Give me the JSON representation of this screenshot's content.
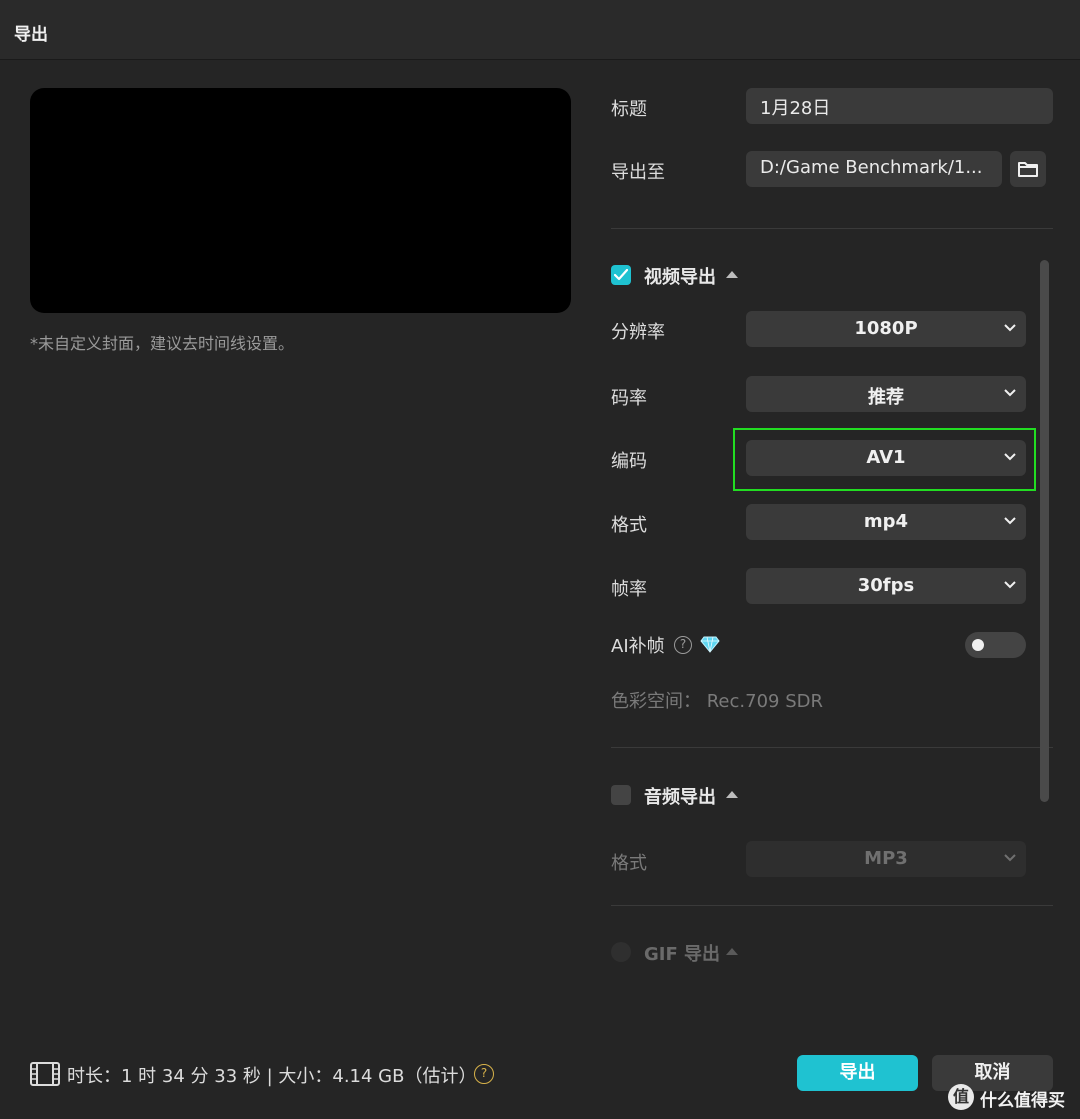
{
  "dialog": {
    "title": "导出"
  },
  "preview": {
    "hint": "*未自定义封面，建议去时间线设置。"
  },
  "form": {
    "title_label": "标题",
    "title_value": "1月28日",
    "export_to_label": "导出至",
    "export_path": "D:/Game Benchmark/1..."
  },
  "video": {
    "section_label": "视频导出",
    "checked": true,
    "resolution_label": "分辨率",
    "resolution_value": "1080P",
    "bitrate_label": "码率",
    "bitrate_value": "推荐",
    "codec_label": "编码",
    "codec_value": "AV1",
    "format_label": "格式",
    "format_value": "mp4",
    "framerate_label": "帧率",
    "framerate_value": "30fps",
    "ai_frame_label": "AI补帧",
    "ai_frame_enabled": false,
    "colorspace_text": "色彩空间：  Rec.709 SDR"
  },
  "audio": {
    "section_label": "音频导出",
    "checked": false,
    "format_label": "格式",
    "format_value": "MP3"
  },
  "gif": {
    "section_label": "GIF 导出",
    "checked": false
  },
  "footer": {
    "info": "时长：1 时 34 分 33 秒 | 大小：4.14 GB（估计）",
    "export_button": "导出",
    "cancel_button": "取消"
  },
  "watermark": {
    "badge": "值",
    "text": "什么值得买"
  },
  "colors": {
    "accent": "#1fc2d1",
    "highlight": "#22dd22",
    "background": "#252525"
  },
  "icons": [
    "folder-icon",
    "checkbox-check-icon",
    "chevron-down-icon",
    "caret-up-icon",
    "help-icon",
    "diamond-icon",
    "film-icon"
  ]
}
